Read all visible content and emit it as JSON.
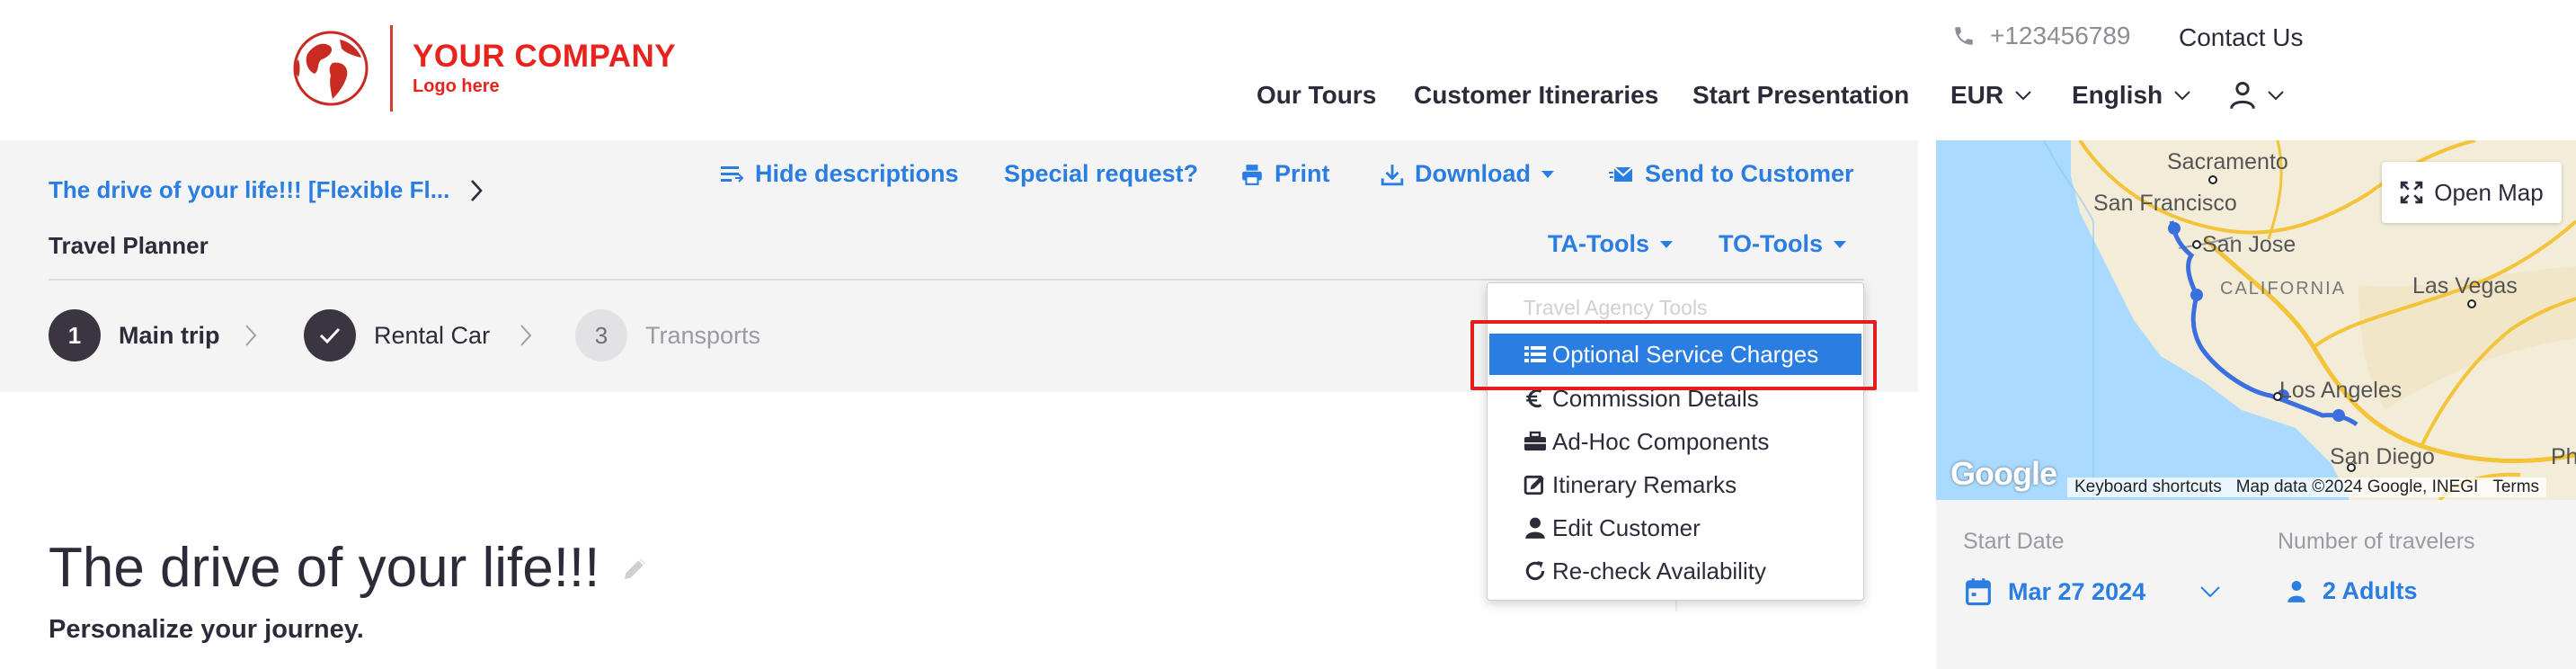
{
  "header": {
    "logo_main": "YOUR COMPANY",
    "logo_sub": "Logo here",
    "phone": "+123456789",
    "contact": "Contact Us",
    "nav": {
      "our_tours": "Our Tours",
      "customer_itineraries": "Customer Itineraries",
      "start_presentation": "Start Presentation",
      "currency": "EUR",
      "language": "English"
    }
  },
  "toolbar": {
    "breadcrumb": "The drive of your life!!! [Flexible Fl...",
    "planner_label": "Travel Planner",
    "hide_descriptions": "Hide descriptions",
    "special_request": "Special request?",
    "print": "Print",
    "download": "Download",
    "send_to_customer": "Send to Customer",
    "ta_tools": "TA-Tools",
    "to_tools": "TO-Tools"
  },
  "steps": [
    {
      "number": "1",
      "label": "Main trip",
      "state": "current"
    },
    {
      "number": "",
      "label": "Rental Car",
      "state": "done"
    },
    {
      "number": "3",
      "label": "Transports",
      "state": "pending"
    }
  ],
  "dropdown": {
    "header": "Travel Agency Tools",
    "items": [
      {
        "label": "Optional Service Charges",
        "icon": "list-icon",
        "active": true
      },
      {
        "label": "Commission Details",
        "icon": "euro-icon"
      },
      {
        "label": "Ad-Hoc Components",
        "icon": "briefcase-icon"
      },
      {
        "label": "Itinerary Remarks",
        "icon": "edit-icon"
      },
      {
        "label": "Edit Customer",
        "icon": "user-icon"
      },
      {
        "label": "Re-check Availability",
        "icon": "refresh-icon"
      }
    ]
  },
  "main": {
    "title": "The drive of your life!!!",
    "subtitle": "Personalize your journey."
  },
  "map": {
    "open_map": "Open Map",
    "google": "Google",
    "keyboard_shortcuts": "Keyboard shortcuts",
    "map_data": "Map data ©2024 Google, INEGI",
    "terms": "Terms",
    "labels": {
      "sacramento": "Sacramento",
      "san_francisco": "San Francisco",
      "san_jose": "San Jose",
      "california": "CALIFORNIA",
      "las_vegas": "Las Vegas",
      "los_angeles": "Los Angeles",
      "san_diego": "San Diego",
      "ph": "Ph"
    }
  },
  "sidebar": {
    "start_date_label": "Start Date",
    "start_date": "Mar 27 2024",
    "travelers_label": "Number of travelers",
    "travelers": "2 Adults"
  },
  "colors": {
    "accent": "#2a7de1",
    "brand": "#e8231d",
    "highlight": "#e31d1d",
    "panel": "#f4f4f4"
  }
}
